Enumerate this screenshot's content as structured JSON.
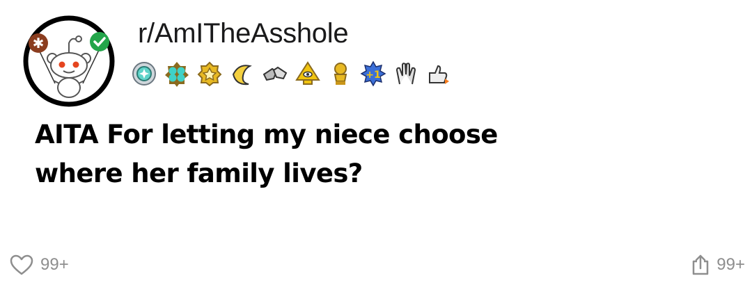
{
  "subreddit": {
    "name": "r/AmITheAsshole",
    "avatar_icon": "reddit-snoo-holding-balloons-icon"
  },
  "awards": [
    {
      "icon": "silver-award-icon"
    },
    {
      "icon": "platinum-award-icon"
    },
    {
      "icon": "gold-award-icon"
    },
    {
      "icon": "banana-award-icon"
    },
    {
      "icon": "fist-bump-award-icon"
    },
    {
      "icon": "all-seeing-upvote-award-icon"
    },
    {
      "icon": "trophy-award-icon"
    },
    {
      "icon": "plus-one-award-icon"
    },
    {
      "icon": "clapping-hands-award-icon"
    },
    {
      "icon": "thumbs-up-rocket-award-icon"
    }
  ],
  "post": {
    "title": "AITA For letting my niece choose where her family lives?"
  },
  "footer": {
    "likes": {
      "icon": "heart-icon",
      "count": "99+"
    },
    "shares": {
      "icon": "share-icon",
      "count": "99+"
    }
  },
  "colors": {
    "text": "#000000",
    "muted": "#8e8e8e",
    "accent_green": "#23a54a",
    "accent_brown": "#8b3d1f",
    "gold": "#e8b923"
  }
}
